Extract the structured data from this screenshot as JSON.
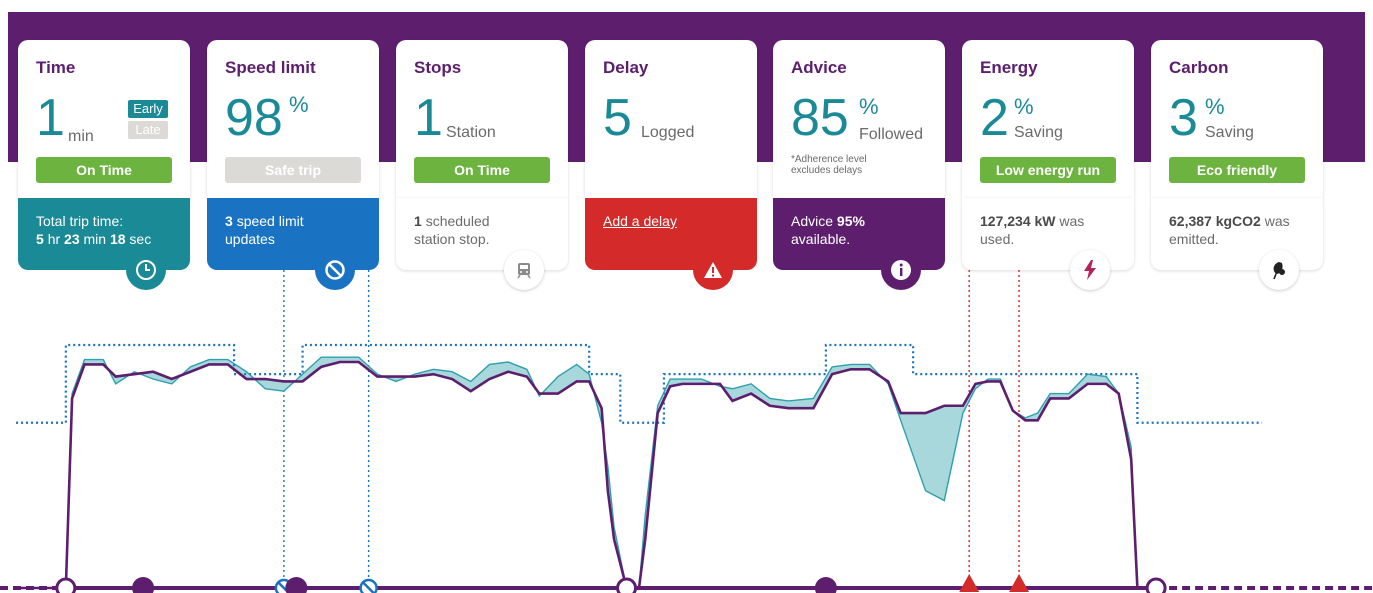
{
  "cards": {
    "time": {
      "title": "Time",
      "value": "1",
      "unit": "min",
      "tag_early": "Early",
      "tag_late": "Late",
      "status": "On Time",
      "detail_line1": "Total trip time:",
      "detail_hr": "5",
      "detail_hr_unit": "hr",
      "detail_min": "23",
      "detail_min_unit": "min",
      "detail_sec": "18",
      "detail_sec_unit": "sec",
      "icon": "clock-icon",
      "color": "#1b8a97"
    },
    "speed_limit": {
      "title": "Speed limit",
      "value": "98",
      "unit": "%",
      "status": "Safe trip",
      "detail_count": "3",
      "detail_text": "speed limit updates",
      "icon": "no-entry-icon",
      "color": "#1a73c2"
    },
    "stops": {
      "title": "Stops",
      "value": "1",
      "unit": "Station",
      "status": "On Time",
      "detail_count": "1",
      "detail_text": "scheduled station stop.",
      "icon": "train-icon"
    },
    "delay": {
      "title": "Delay",
      "value": "5",
      "unit": "Logged",
      "link": "Add a delay",
      "icon": "warning-icon",
      "color": "#d42a2a"
    },
    "advice": {
      "title": "Advice",
      "value": "85",
      "unit_sup": "%",
      "unit": "Followed",
      "footnote_line1": "*Adherence level",
      "footnote_line2": "excludes delays",
      "detail_prefix": "Advice",
      "detail_value": "95%",
      "detail_suffix": "available.",
      "icon": "info-icon",
      "color": "#5e1e6e"
    },
    "energy": {
      "title": "Energy",
      "value": "2",
      "unit_sup": "%",
      "unit": "Saving",
      "status": "Low energy run",
      "detail_value": "127,234 kW",
      "detail_text": "was used.",
      "icon": "lightning-icon"
    },
    "carbon": {
      "title": "Carbon",
      "value": "3",
      "unit_sup": "%",
      "unit": "Saving",
      "status": "Eco friendly",
      "detail_value": "62,387 kgCO2",
      "detail_text": "was emitted.",
      "icon": "leaf-icon"
    }
  },
  "chart_data": {
    "type": "line",
    "x_range": [
      0,
      1000
    ],
    "y_range": [
      0,
      100
    ],
    "series": [
      {
        "role": "actual-speed",
        "color": "#5e1e6e",
        "points": [
          [
            0,
            0
          ],
          [
            40,
            0
          ],
          [
            45,
            78
          ],
          [
            55,
            92
          ],
          [
            70,
            92
          ],
          [
            80,
            87
          ],
          [
            95,
            88
          ],
          [
            110,
            89
          ],
          [
            125,
            86
          ],
          [
            140,
            89
          ],
          [
            155,
            92
          ],
          [
            170,
            92
          ],
          [
            185,
            86
          ],
          [
            200,
            86
          ],
          [
            215,
            85
          ],
          [
            230,
            85
          ],
          [
            245,
            91
          ],
          [
            260,
            93
          ],
          [
            275,
            93
          ],
          [
            290,
            87
          ],
          [
            305,
            87
          ],
          [
            320,
            87
          ],
          [
            335,
            88
          ],
          [
            350,
            86
          ],
          [
            365,
            81
          ],
          [
            380,
            86
          ],
          [
            395,
            89
          ],
          [
            410,
            87
          ],
          [
            420,
            80
          ],
          [
            435,
            80
          ],
          [
            450,
            85
          ],
          [
            460,
            85
          ],
          [
            470,
            74
          ],
          [
            475,
            40
          ],
          [
            480,
            20
          ],
          [
            490,
            0
          ],
          [
            500,
            0
          ],
          [
            505,
            20
          ],
          [
            515,
            72
          ],
          [
            525,
            83
          ],
          [
            535,
            84
          ],
          [
            550,
            84
          ],
          [
            565,
            84
          ],
          [
            575,
            77
          ],
          [
            590,
            80
          ],
          [
            605,
            75
          ],
          [
            620,
            74
          ],
          [
            640,
            74
          ],
          [
            655,
            88
          ],
          [
            670,
            90
          ],
          [
            685,
            90
          ],
          [
            700,
            85
          ],
          [
            710,
            72
          ],
          [
            730,
            72
          ],
          [
            745,
            75
          ],
          [
            760,
            75
          ],
          [
            770,
            84
          ],
          [
            780,
            85
          ],
          [
            790,
            85
          ],
          [
            800,
            73
          ],
          [
            810,
            69
          ],
          [
            820,
            69
          ],
          [
            830,
            78
          ],
          [
            845,
            78
          ],
          [
            860,
            84
          ],
          [
            875,
            84
          ],
          [
            885,
            80
          ],
          [
            895,
            53
          ],
          [
            900,
            0
          ],
          [
            915,
            0
          ]
        ]
      },
      {
        "role": "advised-speed",
        "color": "#2f9fae",
        "points": [
          [
            0,
            0
          ],
          [
            40,
            0
          ],
          [
            45,
            80
          ],
          [
            55,
            94
          ],
          [
            70,
            94
          ],
          [
            80,
            84
          ],
          [
            95,
            89
          ],
          [
            110,
            86
          ],
          [
            125,
            84
          ],
          [
            140,
            91
          ],
          [
            155,
            94
          ],
          [
            170,
            94
          ],
          [
            185,
            89
          ],
          [
            200,
            82
          ],
          [
            215,
            81
          ],
          [
            230,
            88
          ],
          [
            245,
            95
          ],
          [
            260,
            95
          ],
          [
            275,
            95
          ],
          [
            290,
            88
          ],
          [
            305,
            85
          ],
          [
            320,
            88
          ],
          [
            335,
            90
          ],
          [
            350,
            89
          ],
          [
            365,
            85
          ],
          [
            380,
            92
          ],
          [
            395,
            93
          ],
          [
            410,
            90
          ],
          [
            420,
            79
          ],
          [
            435,
            87
          ],
          [
            450,
            92
          ],
          [
            460,
            88
          ],
          [
            470,
            68
          ],
          [
            475,
            50
          ],
          [
            480,
            25
          ],
          [
            490,
            0
          ],
          [
            500,
            0
          ],
          [
            505,
            30
          ],
          [
            515,
            75
          ],
          [
            525,
            86
          ],
          [
            535,
            86
          ],
          [
            550,
            86
          ],
          [
            565,
            83
          ],
          [
            575,
            82
          ],
          [
            590,
            84
          ],
          [
            605,
            78
          ],
          [
            620,
            77
          ],
          [
            640,
            78
          ],
          [
            655,
            91
          ],
          [
            670,
            92
          ],
          [
            685,
            92
          ],
          [
            700,
            84
          ],
          [
            710,
            69
          ],
          [
            730,
            40
          ],
          [
            745,
            36
          ],
          [
            760,
            72
          ],
          [
            770,
            82
          ],
          [
            780,
            86
          ],
          [
            790,
            86
          ],
          [
            800,
            73
          ],
          [
            810,
            70
          ],
          [
            820,
            72
          ],
          [
            830,
            80
          ],
          [
            845,
            80
          ],
          [
            860,
            88
          ],
          [
            875,
            87
          ],
          [
            885,
            80
          ],
          [
            895,
            58
          ],
          [
            900,
            0
          ],
          [
            915,
            0
          ]
        ]
      },
      {
        "role": "speed-limit",
        "color": "#1a73c2",
        "points": [
          [
            0,
            68
          ],
          [
            40,
            68
          ],
          [
            40,
            100
          ],
          [
            175,
            100
          ],
          [
            175,
            88
          ],
          [
            230,
            88
          ],
          [
            230,
            100
          ],
          [
            460,
            100
          ],
          [
            460,
            88
          ],
          [
            485,
            88
          ],
          [
            485,
            68
          ],
          [
            520,
            68
          ],
          [
            520,
            88
          ],
          [
            650,
            88
          ],
          [
            650,
            100
          ],
          [
            720,
            100
          ],
          [
            720,
            88
          ],
          [
            900,
            88
          ],
          [
            900,
            68
          ],
          [
            1000,
            68
          ]
        ]
      }
    ],
    "markers": [
      {
        "x": 40,
        "kind": "station",
        "color": "#5e1e6e"
      },
      {
        "x": 102,
        "kind": "advice",
        "color": "#5e1e6e"
      },
      {
        "x": 215,
        "kind": "speed-limit-update",
        "color": "#1a73c2"
      },
      {
        "x": 225,
        "kind": "advice",
        "color": "#5e1e6e"
      },
      {
        "x": 283,
        "kind": "speed-limit-update",
        "color": "#1a73c2"
      },
      {
        "x": 490,
        "kind": "station",
        "color": "#5e1e6e"
      },
      {
        "x": 650,
        "kind": "advice",
        "color": "#5e1e6e"
      },
      {
        "x": 765,
        "kind": "delay",
        "color": "#d42a2a"
      },
      {
        "x": 805,
        "kind": "delay",
        "color": "#d42a2a"
      },
      {
        "x": 915,
        "kind": "station",
        "color": "#5e1e6e"
      }
    ],
    "grid": false
  }
}
